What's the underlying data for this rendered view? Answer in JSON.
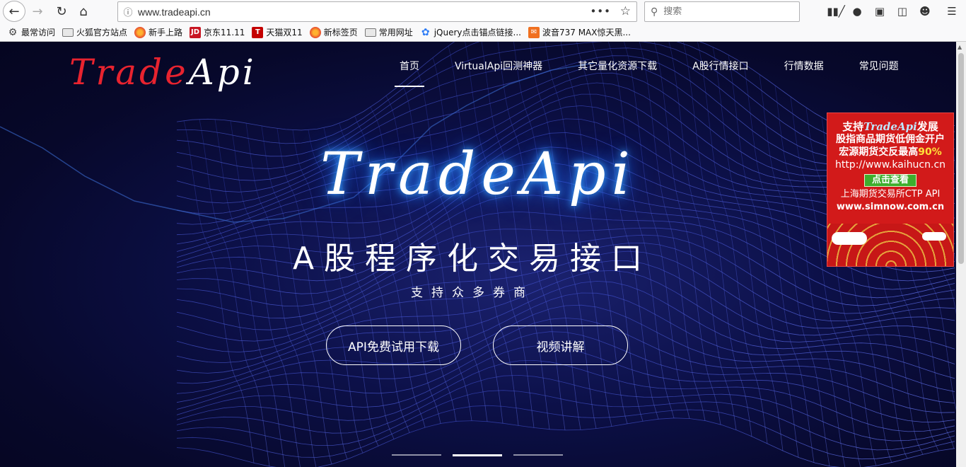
{
  "browser": {
    "url": "www.tradeapi.cn",
    "search_placeholder": "搜索",
    "bookmarks": [
      {
        "label": "最常访问",
        "icon": "gear-icon"
      },
      {
        "label": "火狐官方站点",
        "icon": "folder-icon"
      },
      {
        "label": "新手上路",
        "icon": "firefox-icon"
      },
      {
        "label": "京东11.11",
        "icon": "jd-icon",
        "icon_text": "JD"
      },
      {
        "label": "天猫双11",
        "icon": "tmall-icon",
        "icon_text": "T"
      },
      {
        "label": "新标签页",
        "icon": "firefox-icon"
      },
      {
        "label": "常用网址",
        "icon": "folder-icon"
      },
      {
        "label": "jQuery点击锚点链接...",
        "icon": "baidu-paw-icon"
      },
      {
        "label": "波音737 MAX惊天黑...",
        "icon": "news-icon"
      }
    ]
  },
  "site": {
    "logo_part1": "Trade",
    "logo_part2": "Api",
    "nav": [
      "首页",
      "VirtualApi回测神器",
      "其它量化资源下载",
      "A股行情接口",
      "行情数据",
      "常见问题"
    ],
    "active_nav_index": 0
  },
  "hero": {
    "title": "TradeApi",
    "subtitle": "A股程序化交易接口",
    "subtitle2": "支持众多券商",
    "button_download": "API免费试用下载",
    "button_video": "视频讲解",
    "slides": 3,
    "active_slide": 1
  },
  "ad": {
    "line1_prefix": "支持",
    "line1_brand": "TradeApi",
    "line1_suffix": "发展",
    "line2": "股指商品期货低佣金开户",
    "line3_prefix": "宏源期货交反最高",
    "line3_highlight": "90%",
    "line4": "http://www.kaihucn.cn",
    "button": "点击查看",
    "line5": "上海期货交易所CTP API",
    "line6": "www.simnow.com.cn"
  },
  "colors": {
    "logo_red": "#e8232f",
    "glow": "#2a7dff",
    "ad_red": "#d21a1a",
    "ad_green": "#3eae2d"
  }
}
